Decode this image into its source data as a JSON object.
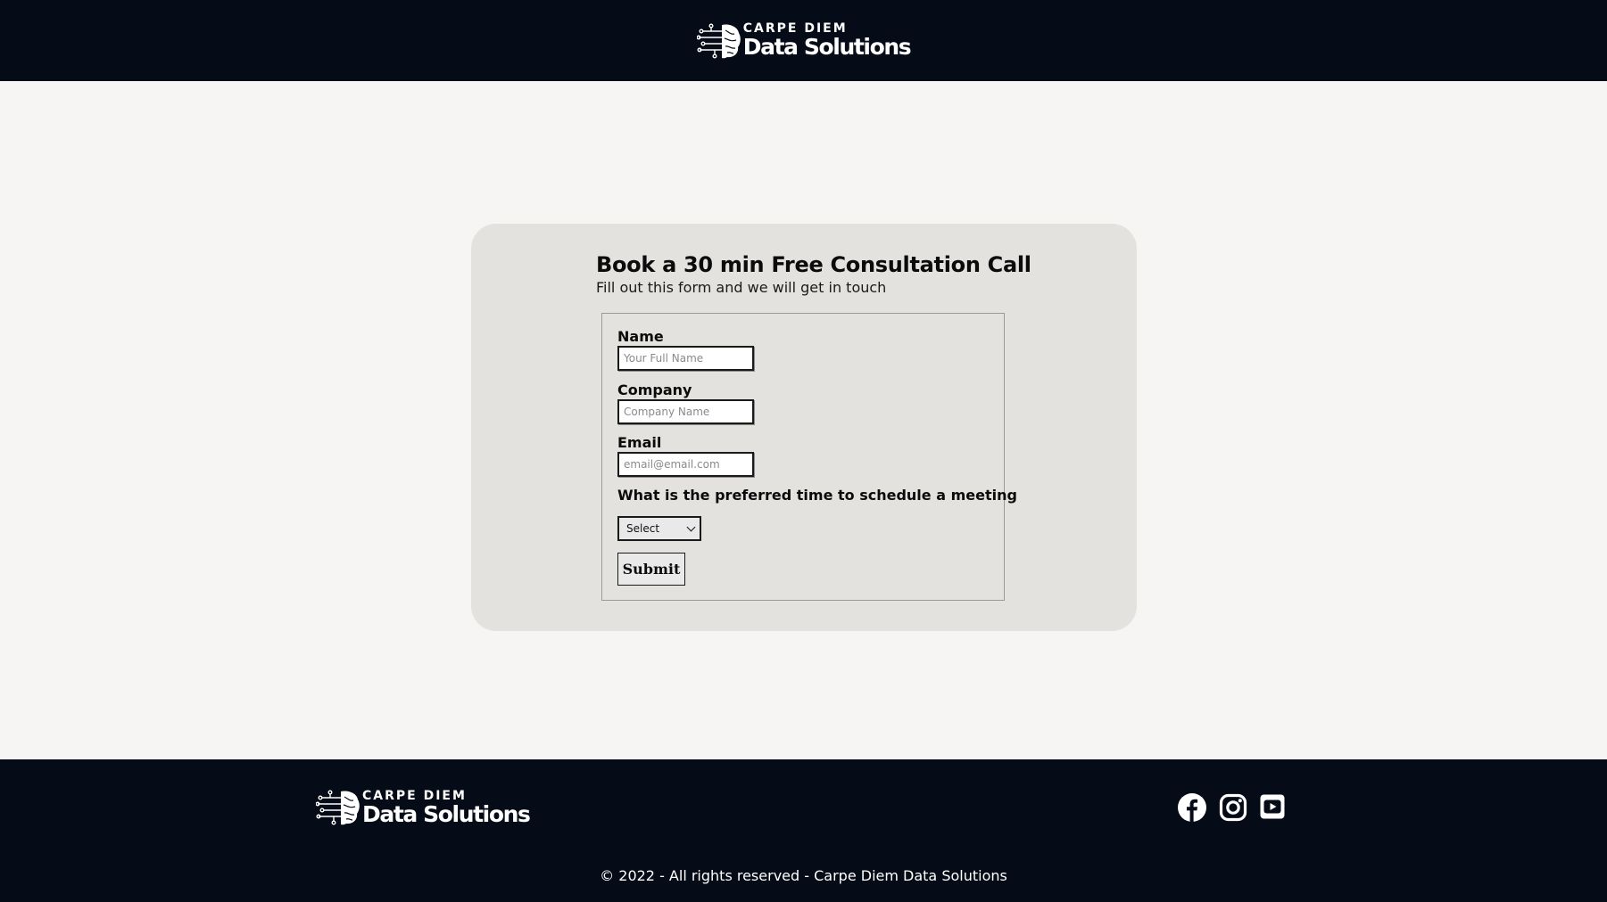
{
  "header": {
    "logo": {
      "top_text": "CARPE DIEM",
      "bottom_text": "Data Solutions"
    }
  },
  "form_card": {
    "title": "Book a 30 min Free Consultation Call",
    "subtitle": "Fill out this form and we will get in touch",
    "fields": {
      "name": {
        "label": "Name",
        "placeholder": "Your Full Name",
        "value": ""
      },
      "company": {
        "label": "Company",
        "placeholder": "Company Name",
        "value": ""
      },
      "email": {
        "label": "Email",
        "placeholder": "email@email.com",
        "value": ""
      }
    },
    "meeting_time": {
      "label": "What is the preferred time to schedule a meeting",
      "selected": "Select"
    },
    "submit_label": "Submit"
  },
  "footer": {
    "logo": {
      "top_text": "CARPE DIEM",
      "bottom_text": "Data Solutions"
    },
    "social_icons": [
      "facebook-icon",
      "instagram-icon",
      "youtube-icon"
    ],
    "copyright": "© 2022 - All rights reserved - Carpe Diem Data Solutions"
  },
  "colors": {
    "header_background": "#050b17",
    "page_background": "#f6f5f3",
    "card_background": "#e4e2df"
  }
}
